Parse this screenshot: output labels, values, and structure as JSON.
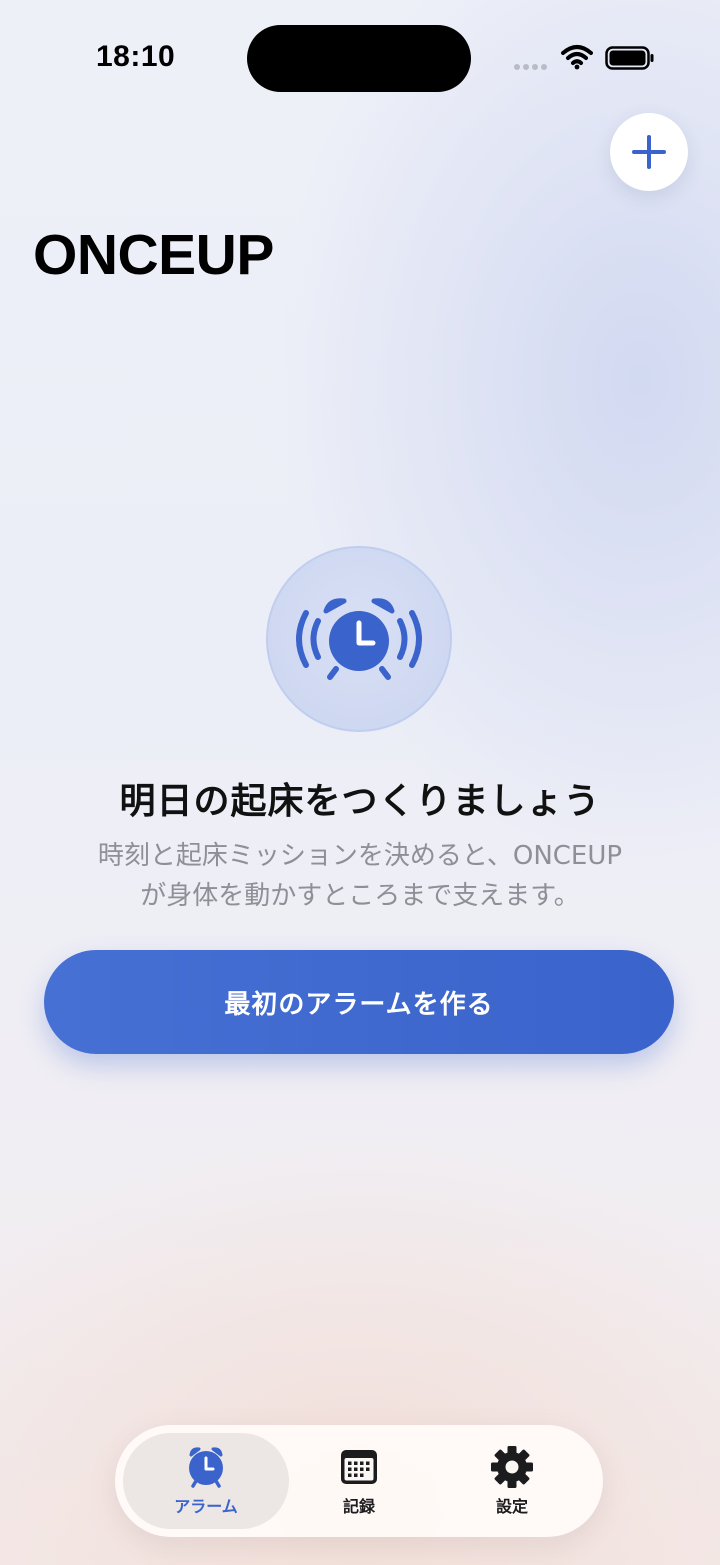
{
  "status_bar": {
    "time": "18:10",
    "icons": [
      "signal-dots-icon",
      "wifi-icon",
      "battery-icon"
    ]
  },
  "header": {
    "title": "ONCEUP",
    "add_button_icon": "plus-icon"
  },
  "empty_state": {
    "icon": "alarm-clock-ringing-icon",
    "title": "明日の起床をつくりましょう",
    "description_line1": "時刻と起床ミッションを決めると、ONCEUP",
    "description_line2": "が身体を動かすところまで支えます。",
    "primary_button_label": "最初のアラームを作る"
  },
  "tab_bar": {
    "tabs": [
      {
        "label": "アラーム",
        "icon": "alarm-clock-icon",
        "active": true
      },
      {
        "label": "記録",
        "icon": "calendar-icon",
        "active": false
      },
      {
        "label": "設定",
        "icon": "gear-icon",
        "active": false
      }
    ]
  },
  "colors": {
    "accent": "#3a63cc",
    "text_primary": "#111111",
    "text_secondary": "#8e8f97"
  }
}
